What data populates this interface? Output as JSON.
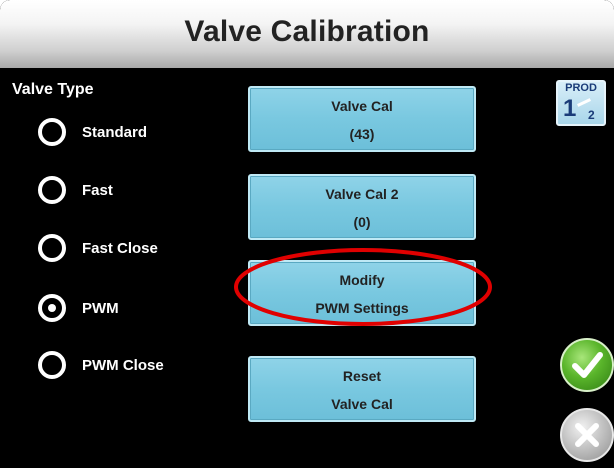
{
  "header": {
    "title": "Valve Calibration"
  },
  "valve_type": {
    "label": "Valve Type",
    "options": [
      {
        "label": "Standard",
        "selected": false
      },
      {
        "label": "Fast",
        "selected": false
      },
      {
        "label": "Fast Close",
        "selected": false
      },
      {
        "label": "PWM",
        "selected": true
      },
      {
        "label": "PWM Close",
        "selected": false
      }
    ]
  },
  "buttons": {
    "valve_cal": {
      "line1": "Valve Cal",
      "line2": "(43)"
    },
    "valve_cal_2": {
      "line1": "Valve Cal 2",
      "line2": "(0)"
    },
    "modify_pwm": {
      "line1": "Modify",
      "line2": "PWM Settings"
    },
    "reset": {
      "line1": "Reset",
      "line2": "Valve Cal"
    }
  },
  "product": {
    "label": "PROD",
    "current": "1",
    "total": "2"
  },
  "icons": {
    "accept": "checkmark-icon",
    "cancel": "x-icon",
    "highlight": "red-ellipse-annotation"
  },
  "colors": {
    "background": "#000000",
    "button_fill": "#79c8e0",
    "accept_green": "#5ab52b",
    "highlight_red": "#e00000"
  }
}
